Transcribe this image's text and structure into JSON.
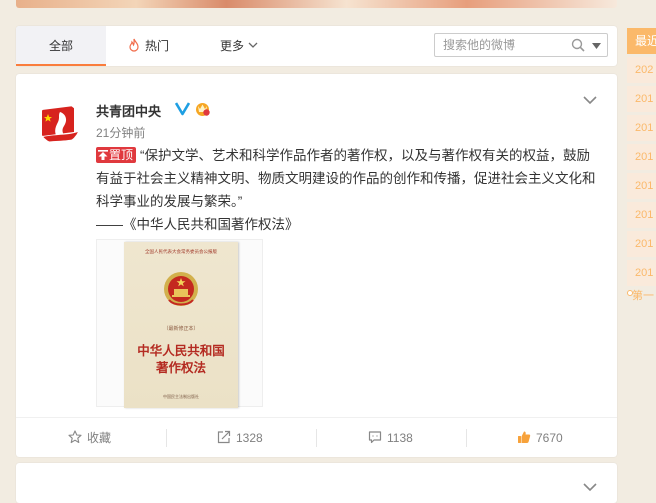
{
  "tabs": {
    "all_label": "全部",
    "hot_label": "热门",
    "more_label": "更多"
  },
  "search": {
    "placeholder": "搜索他的微博"
  },
  "post": {
    "author": "共青团中央",
    "time": "21分钟前",
    "pin_label": "置顶",
    "text": "“保护文学、艺术和科学作品作者的著作权，以及与著作权有关的权益，鼓励有益于社会主义精神文明、物质文明建设的作品的创作和传播，促进社会主义文化和科学事业的发展与繁荣。”",
    "source": "——《中华人民共和国著作权法》",
    "image": {
      "top_line": "全国人民代表大会常务委员会公报版",
      "subtitle": "（最新修正本）",
      "title_line1": "中华人民共和国",
      "title_line2": "著作权法",
      "publisher": "中国民主法制出版社"
    }
  },
  "actions": {
    "favorite_label": "收藏",
    "share_count": "1328",
    "comment_count": "1138",
    "like_count": "7670"
  },
  "sidebar": {
    "header": "最近",
    "years": [
      "202",
      "201",
      "201",
      "201",
      "201",
      "201",
      "201",
      "201"
    ],
    "last_label": "第一"
  },
  "colors": {
    "accent": "#fa7d3c",
    "sidebar_orange": "#fbb96a",
    "pin_red": "#e0393e"
  }
}
